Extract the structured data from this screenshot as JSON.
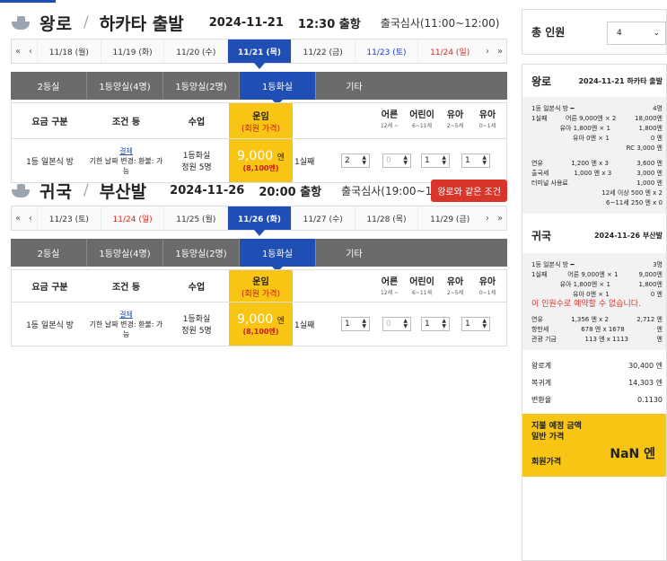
{
  "outbound": {
    "direction": "왕로",
    "sep": "/",
    "port": "하카타 출발",
    "date": "2024-11-21",
    "time": "12:30 출항",
    "immigration": "출국심사(11:00~12:00)",
    "dates": [
      {
        "label": "11/18 (월)",
        "kind": "n"
      },
      {
        "label": "11/19 (화)",
        "kind": "n"
      },
      {
        "label": "11/20 (수)",
        "kind": "n"
      },
      {
        "label": "11/21 (목)",
        "kind": "sel"
      },
      {
        "label": "11/22 (금)",
        "kind": "n"
      },
      {
        "label": "11/23 (토)",
        "kind": "sat"
      },
      {
        "label": "11/24 (일)",
        "kind": "sun"
      }
    ],
    "tabs": [
      "2등실",
      "1등양실(4명)",
      "1등양실(2명)",
      "1등화실",
      "기타"
    ],
    "row": {
      "fare": "1등 일본식 방",
      "cond_link": "결제",
      "cond_text": "기한 날짜 변경: 환불: 가능",
      "room": "1등화실",
      "cap": "정원 5명",
      "price": "9,000",
      "unit": "엔",
      "member": "(8,100엔)",
      "room_no": "1실째",
      "adult": "2",
      "child": "0",
      "infant": "1",
      "baby": "1"
    }
  },
  "inbound": {
    "direction": "귀국",
    "sep": "/",
    "port": "부산발",
    "date": "2024-11-26",
    "time": "20:00 출항",
    "immigration": "출국심사(19:00~19:30)",
    "same_btn": "왕로와 같은 조건",
    "dates": [
      {
        "label": "11/23 (토)",
        "kind": "n"
      },
      {
        "label": "11/24 (일)",
        "kind": "sun"
      },
      {
        "label": "11/25 (월)",
        "kind": "n"
      },
      {
        "label": "11/26 (화)",
        "kind": "sel"
      },
      {
        "label": "11/27 (수)",
        "kind": "n"
      },
      {
        "label": "11/28 (목)",
        "kind": "n"
      },
      {
        "label": "11/29 (금)",
        "kind": "n"
      }
    ],
    "tabs": [
      "2등실",
      "1등양실(4명)",
      "1등양실(2명)",
      "1등화실",
      "기타"
    ],
    "row": {
      "fare": "1등 일본식 방",
      "cond_link": "결제",
      "cond_text": "기한 날짜 변경: 환불: 가능",
      "room": "1등화실",
      "cap": "정원 5명",
      "price": "9,000",
      "unit": "엔",
      "member": "(8,100엔)",
      "room_no": "1실째",
      "adult": "1",
      "child": "0",
      "infant": "1",
      "baby": "1"
    }
  },
  "nav": {
    "first": "«",
    "prev": "‹",
    "next": "›",
    "last": "»"
  },
  "headers": {
    "fare": "요금 구분",
    "cond": "조건 등",
    "room": "수업",
    "price1": "운임",
    "price2": "(회원 가격)",
    "adult": "어른",
    "adult_age": "12세 ~",
    "child": "어린이",
    "child_age": "6~11세",
    "infant": "유아",
    "infant_age": "2~5세",
    "baby": "유아",
    "baby_age": "0~1세"
  },
  "side": {
    "total_label": "총 인원",
    "total_value": "4",
    "out_title": "왕로",
    "out_date": "2024-11-21 하카타 출발",
    "out": {
      "l1a": "1등 일본식 방 ━",
      "l1b": "4명",
      "l2a": "1실째",
      "l2b": "어른 9,000엔 × 2",
      "l2c": "18,000엔",
      "l3b": "유아 1,800엔 × 1",
      "l3c": "1,800엔",
      "l4b": "유아 0엔 × 1",
      "l4c": "0 엔",
      "l5c": "RC 3,000 엔",
      "f1a": "연유",
      "f1b": "1,200 엔 x 3",
      "f1c": "3,600 엔",
      "f2a": "출국세",
      "f2b": "1,000 엔 x 3",
      "f2c": "3,000 엔",
      "f3a": "터미널 사용료",
      "f3c": "1,000 엔",
      "f4": "12세 이상 500 엔 x 2",
      "f5": "6~11세 250 엔 x 0"
    },
    "in_title": "귀국",
    "in_date": "2024-11-26 부산발",
    "in": {
      "l1a": "1등 일본식 방 ━",
      "l1b": "3명",
      "l2a": "1실째",
      "l2b": "어른 9,000엔 × 1",
      "l2c": "9,000엔",
      "l3b": "유아 1,800엔 × 1",
      "l3c": "1,800엔",
      "l4b": "유아 0엔 × 1",
      "l4c": "0 엔",
      "warn": "이 인원수로 예약할 수 없습니다.",
      "f1a": "연유",
      "f1b": "1,356 엔 x 2",
      "f1c": "2,712 엔",
      "f2a": "항만세",
      "f2b": "678 엔 x 1678",
      "f2c": "엔",
      "f3a": "관광 기금",
      "f3b": "113 엔 x 1113",
      "f3c": "엔"
    },
    "t1a": "왕로계",
    "t1b": "30,400 엔",
    "t2a": "복귀계",
    "t2b": "14,303 엔",
    "t3a": "변환율",
    "t3b": "0.1130",
    "pay1": "지불 예정 금액",
    "pay2": "일반 가격",
    "pay_val": "NaN 엔",
    "pay3": "회원가격"
  }
}
